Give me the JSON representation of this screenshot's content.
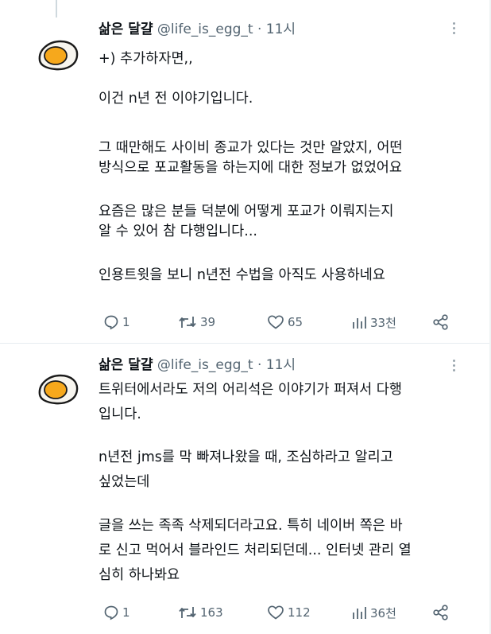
{
  "tweets": [
    {
      "name": "삶은 달걀",
      "handle": "@life_is_egg_t",
      "separator": "·",
      "time": "11시",
      "paragraphs": [
        [
          "+) 추가하자면,,"
        ],
        [
          "이건 n년 전 이야기입니다."
        ],
        [
          "그 때만해도 사이비 종교가 있다는 것만 알았지, 어떤",
          "방식으로 포교활동을 하는지에 대한 정보가 없었어요"
        ],
        [
          "요즘은 많은 분들 덕분에 어떻게 포교가 이뤄지는지",
          "알 수 있어 참 다행입니다..."
        ],
        [
          "인용트윗을 보니 n년전 수법을 아직도 사용하네요"
        ]
      ],
      "stats": {
        "replies": "1",
        "retweets": "39",
        "likes": "65",
        "views": "33천"
      }
    },
    {
      "name": "삶은 달걀",
      "handle": "@life_is_egg_t",
      "separator": "·",
      "time": "11시",
      "paragraphs": [
        [
          "트위터에서라도 저의 어리석은 이야기가 퍼져서 다행",
          "입니다."
        ],
        [
          "n년전 jms를 막 빠져나왔을 때, 조심하라고 알리고",
          "싶었는데"
        ],
        [
          "글을 쓰는 족족 삭제되더라고요. 특히 네이버 쪽은 바",
          "로 신고 먹어서 블라인드 처리되던데... 인터넷 관리 열",
          "심히 하나봐요"
        ]
      ],
      "stats": {
        "replies": "1",
        "retweets": "163",
        "likes": "112",
        "views": "36천"
      }
    }
  ],
  "icons": {
    "avatar": "boiled-egg-icon",
    "more": "more-vertical-icon",
    "reply": "reply-icon",
    "retweet": "retweet-icon",
    "like": "heart-icon",
    "views": "views-icon",
    "share": "share-icon"
  },
  "colors": {
    "text": "#0f1419",
    "secondary": "#536471",
    "divider": "#e6ecf0",
    "egg_white": "#f7f5ef",
    "egg_yolk": "#f6a81c"
  }
}
